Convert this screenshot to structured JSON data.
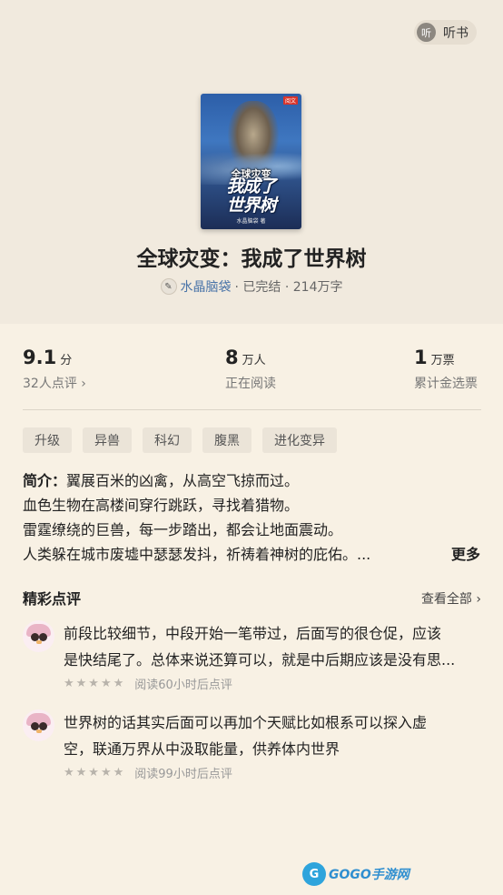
{
  "header": {
    "listen_icon_label": "听",
    "listen_label": "听书"
  },
  "cover": {
    "publisher_mark": "阅文",
    "sub_title": "全球灾变",
    "main_title_line1": "我成了",
    "main_title_line2": "世界树",
    "author_mark": "水晶脑袋 著"
  },
  "book": {
    "title": "全球灾变：我成了世界树",
    "author": "水晶脑袋",
    "meta": "· 已完结 · 214万字"
  },
  "stats": {
    "score_value": "9.1",
    "score_unit": "分",
    "score_sub": "32人点评 ›",
    "readers_value": "8",
    "readers_unit": "万人",
    "readers_sub": "正在阅读",
    "votes_value": "1",
    "votes_unit": "万票",
    "votes_sub": "累计金选票"
  },
  "tags": [
    "升级",
    "异兽",
    "科幻",
    "腹黑",
    "进化变异"
  ],
  "intro": {
    "label": "简介：",
    "line1": "翼展百米的凶禽，从高空飞掠而过。",
    "line2": "血色生物在高楼间穿行跳跃，寻找着猎物。",
    "line3": "雷霆缭绕的巨兽，每一步踏出，都会让地面震动。",
    "line4": "人类躲在城市废墟中瑟瑟发抖，祈祷着神树的庇佑。...",
    "more_label": "更多"
  },
  "reviews": {
    "title": "精彩点评",
    "view_all": "查看全部 ›",
    "items": [
      {
        "line1": "前段比较细节，中段开始一笔带过，后面写的很仓促，应该",
        "line2": "是快结尾了。总体来说还算可以，就是中后期应该是没有思...",
        "stars": "★★★★★",
        "meta": "阅读60小时后点评"
      },
      {
        "line1": "世界树的话其实后面可以再加个天赋比如根系可以探入虚",
        "line2": "空，联通万界从中汲取能量，供养体内世界",
        "stars": "★★★★★",
        "meta": "阅读99小时后点评"
      }
    ]
  },
  "watermark": {
    "icon": "G",
    "text": "GOGO手游网"
  }
}
